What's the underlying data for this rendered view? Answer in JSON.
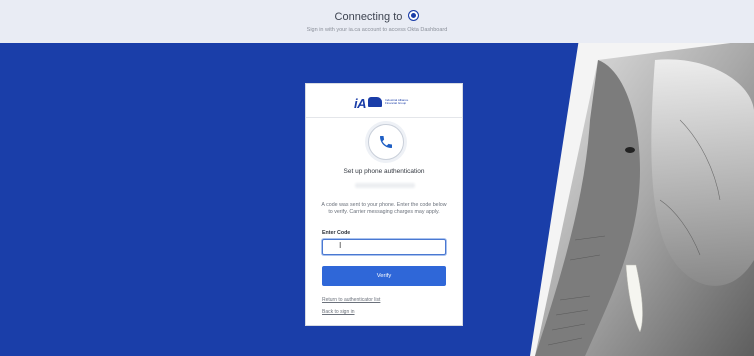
{
  "header": {
    "title": "Connecting to",
    "logo_icon": "ia-logo-circle-icon",
    "subtitle": "Sign in with your ia.ca account to access Okta Dashboard"
  },
  "brand": {
    "mark": "iA",
    "name": "Industrial Alliance Financial Group",
    "elephant_icon": "elephant-logo-icon"
  },
  "card": {
    "phone_icon": "phone-icon",
    "title": "Set up phone authentication",
    "description": "A code was sent to your phone. Enter the code below to verify. Carrier messaging charges may apply.",
    "code_label": "Enter Code",
    "code_value": "",
    "verify_label": "Verify",
    "return_link": "Return to authenticator list",
    "back_link": "Back to sign in"
  },
  "colors": {
    "background_blue": "#1a3ea9",
    "button_blue": "#2f67d8",
    "header_bg": "#e9ecf4"
  }
}
